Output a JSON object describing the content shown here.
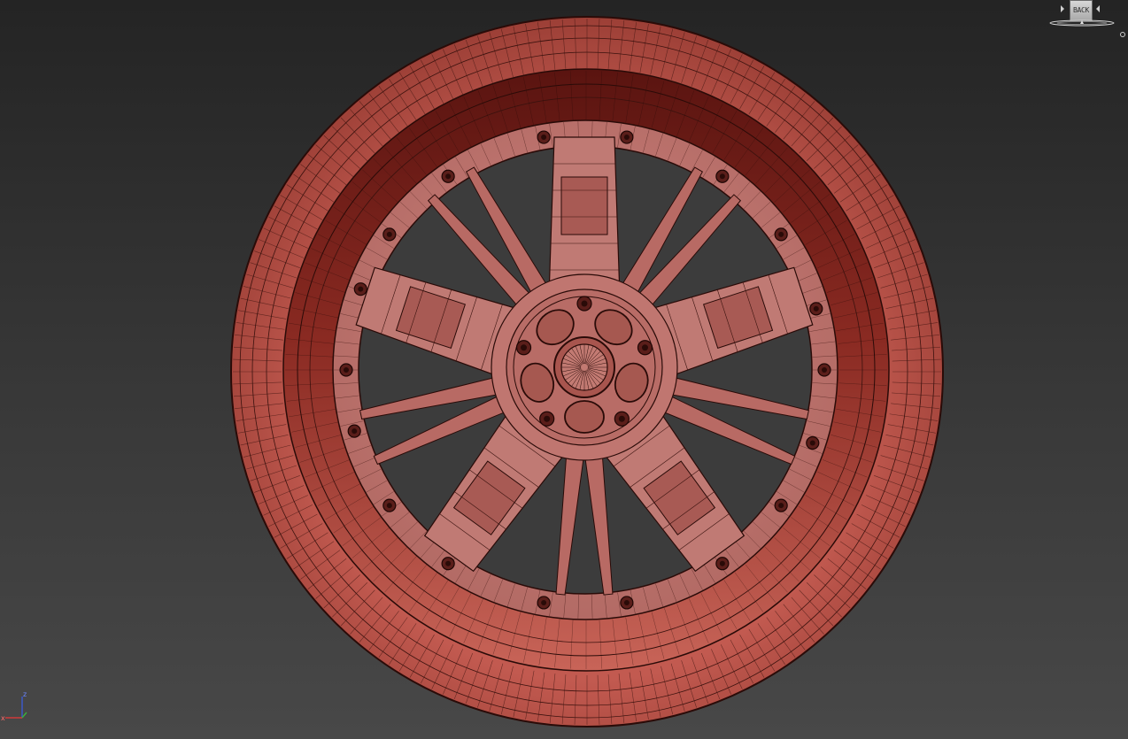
{
  "viewport": {
    "view_label": "BACK",
    "colors": {
      "background_top": "#242424",
      "background_bottom": "#484848",
      "wheel_fill": "#b85a50",
      "wheel_dark": "#6a1c16",
      "wireframe": "#2a0b08"
    }
  },
  "axis_gizmo": {
    "x_label": "x",
    "z_label": "z",
    "colors": {
      "x": "#d03a3a",
      "z": "#3a5ad0",
      "y": "#3ab03a"
    }
  },
  "icons": {
    "viewcube_left": "triangle-left-icon",
    "viewcube_right": "triangle-right-icon",
    "home": "home-icon"
  }
}
